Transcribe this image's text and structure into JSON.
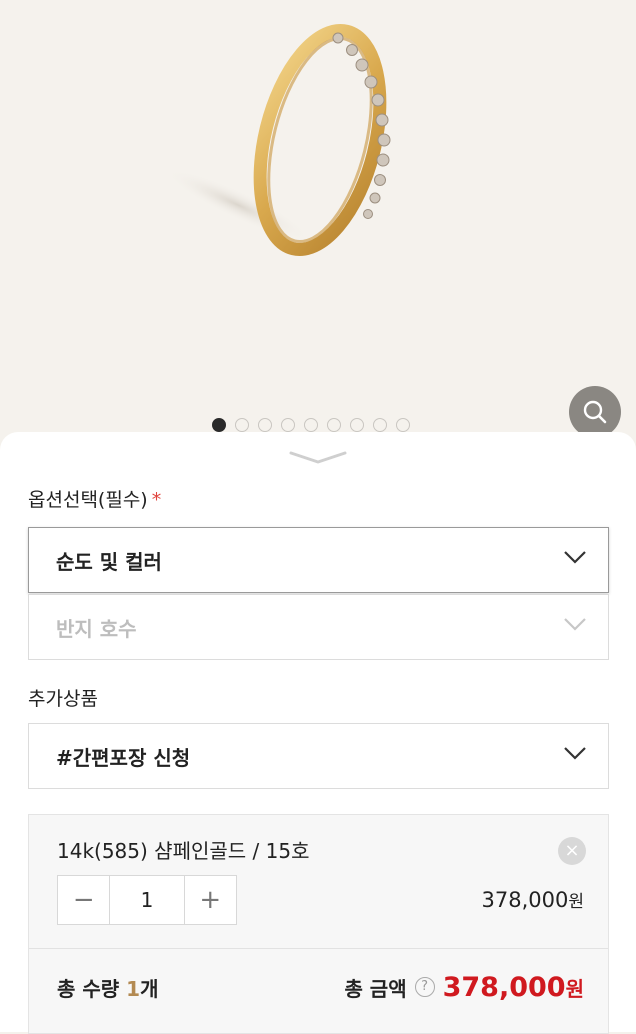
{
  "gallery": {
    "total_slides": 9,
    "active_slide": 1
  },
  "options": {
    "required_label": "옵션선택(필수)",
    "required_mark": "*",
    "purity_color_select": "순도 및 컬러",
    "ring_size_select": "반지 호수"
  },
  "addons": {
    "label": "추가상품",
    "gift_wrap_select": "#간편포장 신청"
  },
  "selected_item": {
    "title": "14k(585) 샴페인골드 / 15호",
    "quantity": "1",
    "minus": "−",
    "plus": "+",
    "price": "378,000",
    "price_unit": "원",
    "remove": "×"
  },
  "summary": {
    "total_qty_label": "총 수량",
    "total_qty_value": "1",
    "total_qty_unit": "개",
    "total_amount_label": "총 금액",
    "help": "?",
    "total_amount_value": "378,000",
    "total_amount_unit": "원"
  },
  "colors": {
    "accent_red": "#d0191f",
    "gold": "#b38a52"
  }
}
